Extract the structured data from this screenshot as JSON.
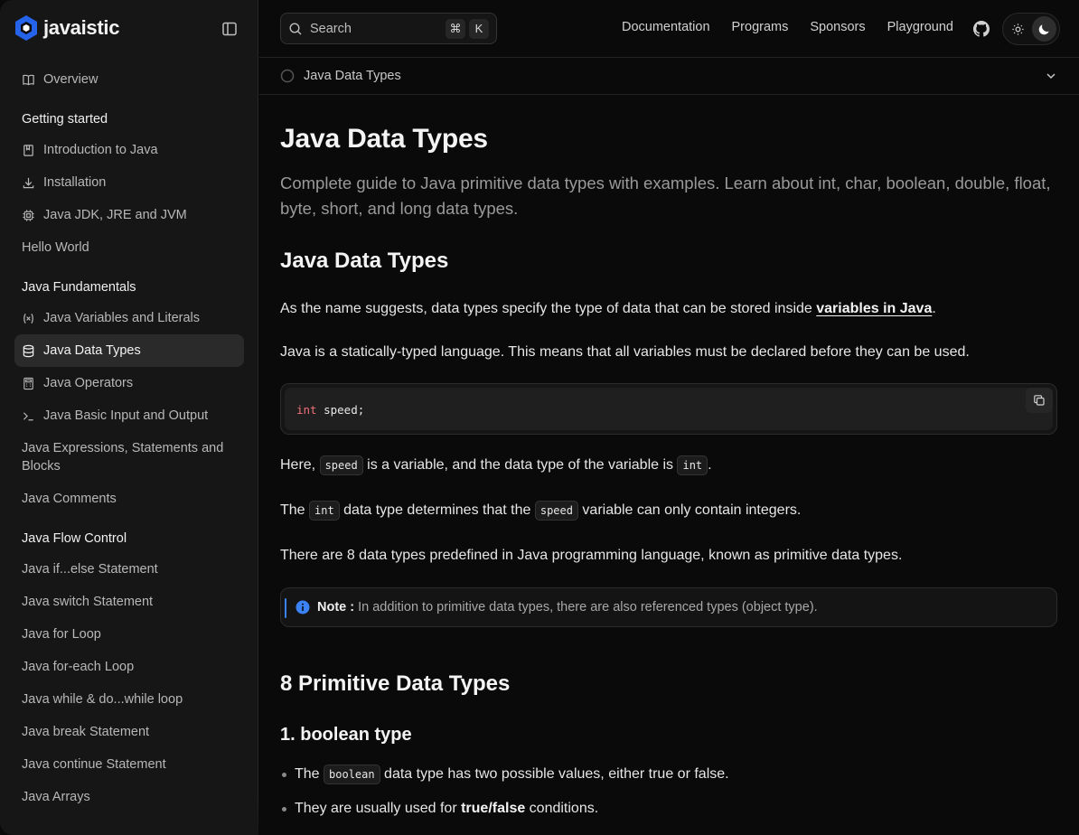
{
  "brand": {
    "name": "javaistic",
    "accent": "#3b82f6"
  },
  "sidebar": {
    "overview": "Overview",
    "sections": [
      {
        "title": "Getting started",
        "items": [
          "Introduction to Java",
          "Installation",
          "Java JDK, JRE and JVM",
          "Hello World"
        ]
      },
      {
        "title": "Java Fundamentals",
        "items": [
          "Java Variables and Literals",
          "Java Data Types",
          "Java Operators",
          "Java Basic Input and Output",
          "Java Expressions, Statements and Blocks",
          "Java Comments"
        ]
      },
      {
        "title": "Java Flow Control",
        "items": [
          "Java if...else Statement",
          "Java switch Statement",
          "Java for Loop",
          "Java for-each Loop",
          "Java while & do...while loop",
          "Java break Statement",
          "Java continue Statement",
          "Java Arrays"
        ]
      }
    ],
    "active": "Java Data Types"
  },
  "topbar": {
    "search_placeholder": "Search",
    "shortcut_keys": [
      "⌘",
      "K"
    ],
    "links": [
      "Documentation",
      "Programs",
      "Sponsors",
      "Playground"
    ],
    "theme": "dark"
  },
  "toc": {
    "current": "Java Data Types"
  },
  "article": {
    "title": "Java Data Types",
    "description": "Complete guide to Java primitive data types with examples. Learn about int, char, boolean, double, float, byte, short, and long data types.",
    "h2_intro": "Java Data Types",
    "p1_before": "As the name suggests, data types specify the type of data that can be stored inside ",
    "p1_link": "variables in Java",
    "p1_after": ".",
    "p2": "Java is a statically-typed language. This means that all variables must be declared before they can be used.",
    "code_keyword": "int",
    "code_rest": " speed;",
    "p3_a": "Here, ",
    "p3_code1": "speed",
    "p3_b": " is a variable, and the data type of the variable is ",
    "p3_code2": "int",
    "p3_c": ".",
    "p4_a": "The ",
    "p4_code1": "int",
    "p4_b": " data type determines that the ",
    "p4_code2": "speed",
    "p4_c": " variable can only contain integers.",
    "p5": "There are 8 data types predefined in Java programming language, known as primitive data types.",
    "note_label": "Note :",
    "note_text": "In addition to primitive data types, there are also referenced types (object type).",
    "h2_primitive": "8 Primitive Data Types",
    "h3_boolean": "1. boolean type",
    "b1_a": "The ",
    "b1_code": "boolean",
    "b1_b": " data type has two possible values, either true or false.",
    "b2_a": "They are usually used for ",
    "b2_bold": "true/false",
    "b2_b": " conditions."
  }
}
